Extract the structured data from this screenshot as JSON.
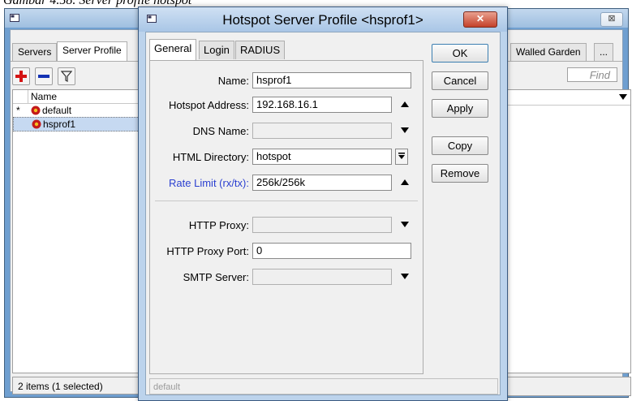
{
  "caption": "Gambar 4.58. Server profile hotspot",
  "background_window": {
    "close_symbol": "⊠",
    "tabs": [
      "Servers",
      "Server Profile"
    ],
    "right_tabs": [
      "Walled Garden",
      "..."
    ],
    "find_placeholder": "Find",
    "list": {
      "column_header": "Name",
      "rows": [
        {
          "marker": "*",
          "name": "default",
          "selected": false
        },
        {
          "marker": "",
          "name": "hsprof1",
          "selected": true
        }
      ]
    },
    "status": "2 items (1 selected)"
  },
  "dialog": {
    "title": "Hotspot Server Profile <hsprof1>",
    "close_symbol": "✕",
    "tabs": [
      "General",
      "Login",
      "RADIUS"
    ],
    "fields": {
      "name": {
        "label": "Name:",
        "value": "hsprof1"
      },
      "hotspot_address": {
        "label": "Hotspot Address:",
        "value": "192.168.16.1"
      },
      "dns_name": {
        "label": "DNS Name:",
        "value": ""
      },
      "html_directory": {
        "label": "HTML Directory:",
        "value": "hotspot"
      },
      "rate_limit": {
        "label": "Rate Limit (rx/tx):",
        "value": "256k/256k"
      },
      "http_proxy": {
        "label": "HTTP Proxy:",
        "value": ""
      },
      "http_proxy_port": {
        "label": "HTTP Proxy Port:",
        "value": "0"
      },
      "smtp_server": {
        "label": "SMTP Server:",
        "value": ""
      }
    },
    "buttons": {
      "ok": "OK",
      "cancel": "Cancel",
      "apply": "Apply",
      "copy": "Copy",
      "remove": "Remove"
    },
    "status": "default"
  },
  "colors": {
    "accent_blue_label": "#2a3fd0",
    "selected_row": "#c6d9f1",
    "close_red": "#c4412a"
  }
}
